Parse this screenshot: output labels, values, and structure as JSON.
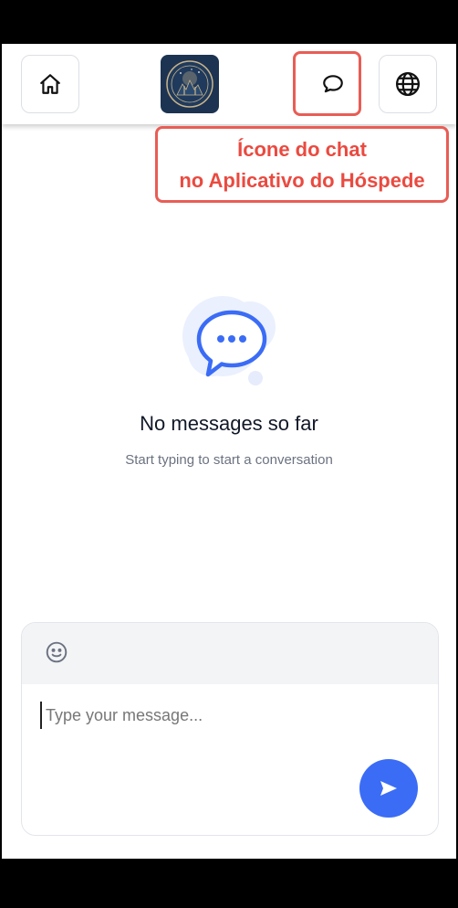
{
  "callout": {
    "line1": "Ícone do chat",
    "line2": "no Aplicativo do Hóspede"
  },
  "empty_state": {
    "title": "No messages so far",
    "subtitle": "Start typing to start a conversation"
  },
  "composer": {
    "placeholder": "Type your message..."
  },
  "icons": {
    "home": "home-icon",
    "chat": "chat-bubble-icon",
    "globe": "globe-icon",
    "emoji": "smiley-icon",
    "send": "send-arrow-icon"
  },
  "colors": {
    "accent": "#3b6cf6",
    "annotation": "#e85d55",
    "logo_bg": "#1d3352"
  }
}
